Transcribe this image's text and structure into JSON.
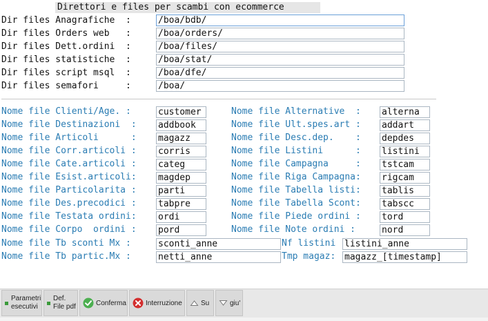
{
  "title": "Direttori e files per scambi con ecommerce",
  "dirs": [
    {
      "label": "Dir files Anagrafiche  :",
      "value": "/boa/bdb/"
    },
    {
      "label": "Dir files Orders web   :",
      "value": "/boa/orders/"
    },
    {
      "label": "Dir files Dett.ordini  :",
      "value": "/boa/files/"
    },
    {
      "label": "Dir files statistiche  :",
      "value": "/boa/stat/"
    },
    {
      "label": "Dir files script msql  :",
      "value": "/boa/dfe/"
    },
    {
      "label": "Dir files semafori     :",
      "value": "/boa/"
    }
  ],
  "files_left": [
    {
      "label": "Nome file Clienti/Age. :",
      "value": "customer"
    },
    {
      "label": "Nome file Destinazioni  :",
      "value": "addbook"
    },
    {
      "label": "Nome file Articoli      :",
      "value": "magazz"
    },
    {
      "label": "Nome file Corr.articoli :",
      "value": "corris"
    },
    {
      "label": "Nome file Cate.articoli :",
      "value": "categ"
    },
    {
      "label": "Nome file Esist.articoli:",
      "value": "magdep"
    },
    {
      "label": "Nome file Particolarita :",
      "value": "parti"
    },
    {
      "label": "Nome file Des.precodici :",
      "value": "tabpre"
    },
    {
      "label": "Nome file Testata ordini:",
      "value": "ordi"
    },
    {
      "label": "Nome file Corpo  ordini :",
      "value": "pord"
    }
  ],
  "files_right": [
    {
      "label": "Nome file Alternative  :",
      "value": "alterna"
    },
    {
      "label": "Nome file Ult.spes.art :",
      "value": "addart"
    },
    {
      "label": "Nome file Desc.dep.    :",
      "value": "depdes"
    },
    {
      "label": "Nome file Listini      :",
      "value": "listini"
    },
    {
      "label": "Nome file Campagna     :",
      "value": "tstcam"
    },
    {
      "label": "Nome file Riga Campagna:",
      "value": "rigcam"
    },
    {
      "label": "Nome file Tabella listi:",
      "value": "tablis"
    },
    {
      "label": "Nome file Tabella Scont:",
      "value": "tabscc"
    },
    {
      "label": "Nome file Piede ordini :",
      "value": "tord"
    },
    {
      "label": "Nome file Note ordini :",
      "value": "nord"
    }
  ],
  "extra_left": [
    {
      "label": "Nome file Tb sconti Mx :",
      "value": "sconti_anne"
    },
    {
      "label": "Nome file Tb partic.Mx :",
      "value": "netti_anne"
    }
  ],
  "extra_right": [
    {
      "label": "Nf listini",
      "value": "listini_anne"
    },
    {
      "label": "Tmp magaz:",
      "value": "magazz_[timestamp]"
    }
  ],
  "toolbar": {
    "parametri_1": "Parametri",
    "parametri_2": "esecutivi",
    "def_1": "Def.",
    "def_2": "File pdf",
    "conferma": "Conferma",
    "interruzione": "Interruzione",
    "su": "Su",
    "giu": "giu'"
  },
  "colors": {
    "label_blue": "#2a7cb3",
    "accent_green": "#3a9a3a",
    "cancel_red": "#d32f2f"
  }
}
